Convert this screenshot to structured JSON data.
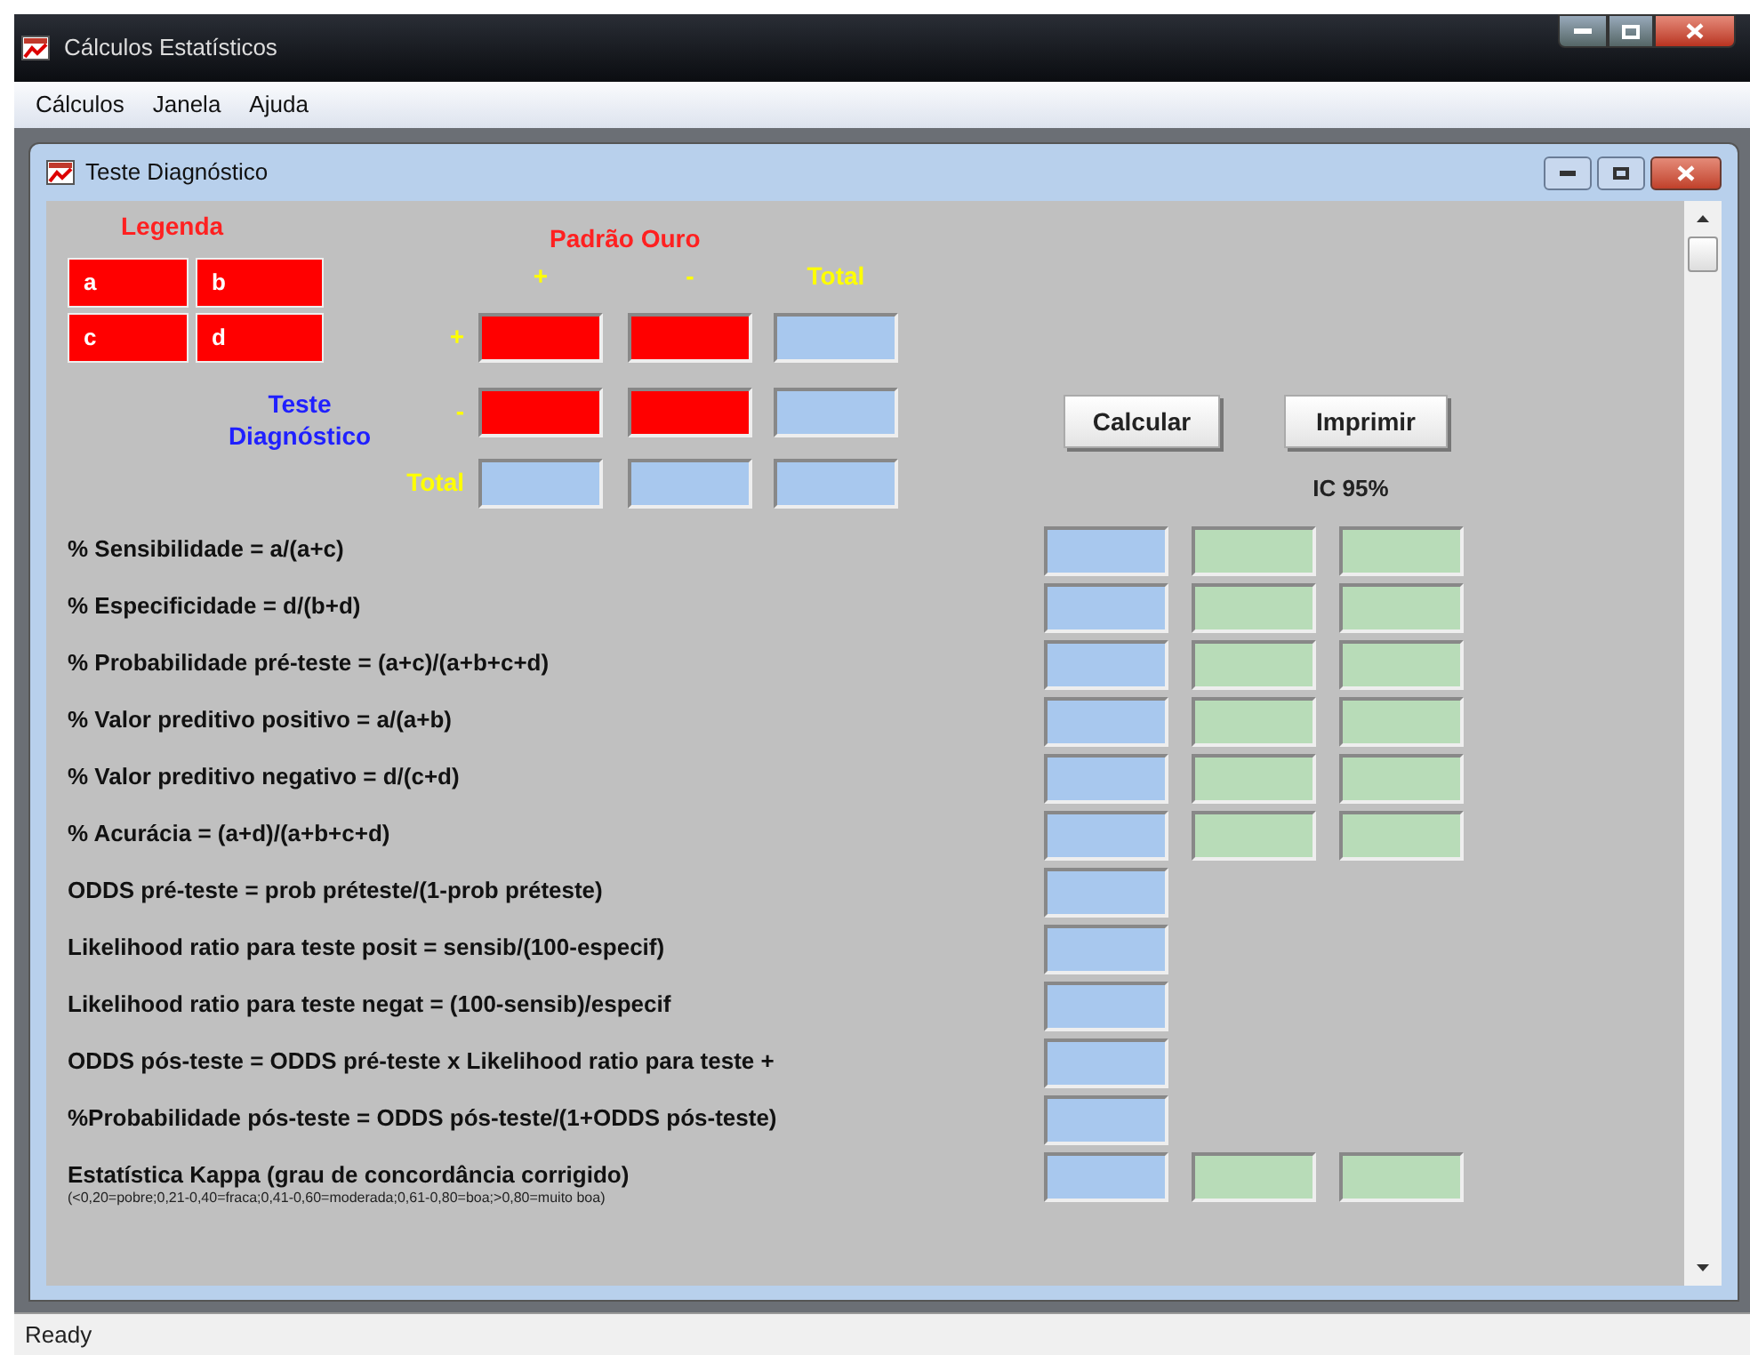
{
  "window": {
    "title": "Cálculos Estatísticos"
  },
  "menu": [
    "Cálculos",
    "Janela",
    "Ajuda"
  ],
  "child_window": {
    "title": "Teste Diagnóstico"
  },
  "legend": {
    "title": "Legenda",
    "cells": [
      "a",
      "b",
      "c",
      "d"
    ]
  },
  "table": {
    "title": "Padrão Ouro",
    "column_headers": [
      "+",
      "-",
      "Total"
    ],
    "row_title": "Teste Diagnóstico",
    "rows": [
      {
        "header": "+",
        "cells": [
          {
            "kind": "input"
          },
          {
            "kind": "input"
          },
          {
            "kind": "result"
          }
        ]
      },
      {
        "header": "-",
        "cells": [
          {
            "kind": "input"
          },
          {
            "kind": "input"
          },
          {
            "kind": "result"
          }
        ]
      },
      {
        "header": "Total",
        "cells": [
          {
            "kind": "result"
          },
          {
            "kind": "result"
          },
          {
            "kind": "result"
          }
        ]
      }
    ]
  },
  "buttons": [
    "Calcular",
    "Imprimir"
  ],
  "ci_label": "IC 95%",
  "statistics": [
    {
      "label": "% Sensibilidade = a/(a+c)",
      "kind": "with_ci"
    },
    {
      "label": "% Especificidade = d/(b+d)",
      "kind": "with_ci"
    },
    {
      "label": "% Probabilidade pré-teste = (a+c)/(a+b+c+d)",
      "kind": "with_ci"
    },
    {
      "label": "% Valor preditivo positivo = a/(a+b)",
      "kind": "with_ci"
    },
    {
      "label": "% Valor preditivo negativo = d/(c+d)",
      "kind": "with_ci"
    },
    {
      "label": "% Acurácia = (a+d)/(a+b+c+d)",
      "kind": "with_ci"
    },
    {
      "label": "ODDS pré-teste = prob préteste/(1-prob préteste)",
      "kind": "single"
    },
    {
      "label": "Likelihood ratio para teste posit = sensib/(100-especif)",
      "kind": "single"
    },
    {
      "label": "Likelihood ratio para teste negat = (100-sensib)/especif",
      "kind": "single"
    },
    {
      "label": "ODDS pós-teste = ODDS pré-teste x Likelihood ratio para teste +",
      "kind": "single"
    },
    {
      "label": "%Probabilidade pós-teste = ODDS pós-teste/(1+ODDS pós-teste)",
      "kind": "single"
    },
    {
      "label": "Estatística Kappa (grau de concordância corrigido)",
      "note": "(<0,20=pobre;0,21-0,40=fraca;0,41-0,60=moderada;0,61-0,80=boa;>0,80=muito boa)",
      "kind": "with_ci"
    }
  ],
  "status_bar": "Ready"
}
